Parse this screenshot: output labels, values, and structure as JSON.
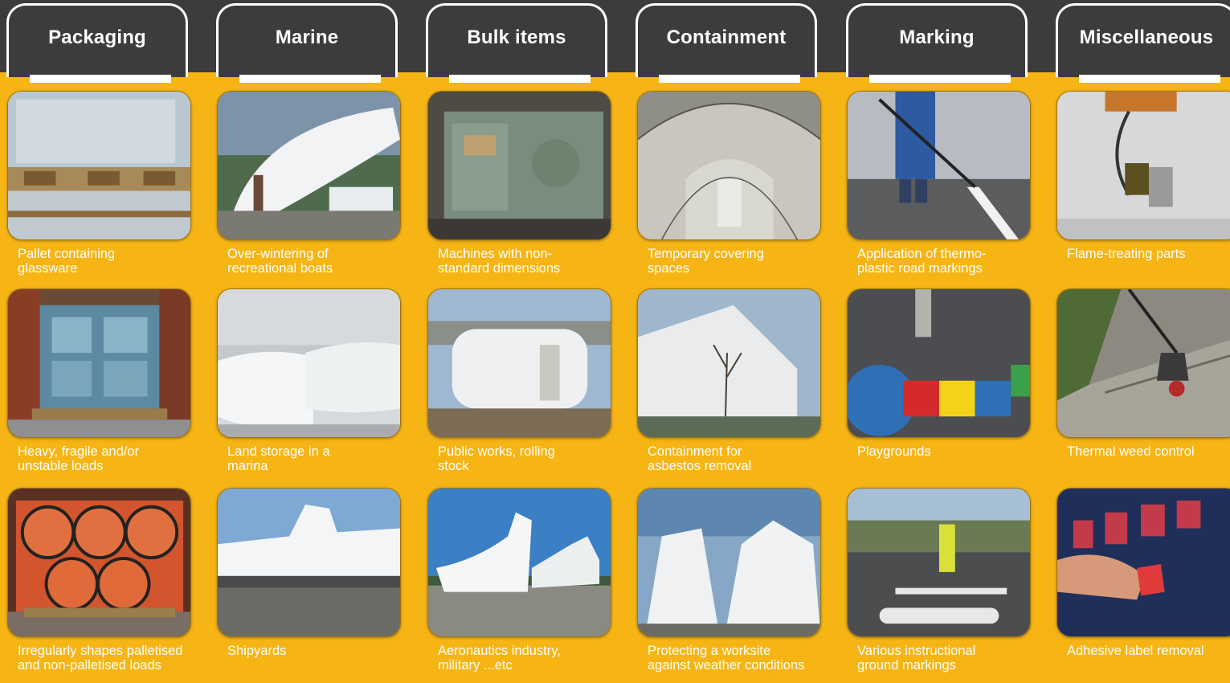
{
  "tabs": [
    {
      "label": "Packaging"
    },
    {
      "label": "Marine"
    },
    {
      "label": "Bulk items"
    },
    {
      "label": "Containment"
    },
    {
      "label": "Marking"
    },
    {
      "label": "Miscellaneous"
    }
  ],
  "columns": [
    {
      "items": [
        {
          "caption": "Pallet containing\nglassware",
          "icon": "pallet-glassware-photo"
        },
        {
          "caption": "Heavy, fragile and/or\nunstable loads",
          "icon": "wrapped-load-photo"
        },
        {
          "caption": "Irregularly shapes palletised\nand non-palletised loads",
          "icon": "irregular-load-photo"
        }
      ]
    },
    {
      "items": [
        {
          "caption": "Over-wintering of\nrecreational boats",
          "icon": "boat-wrapping-photo"
        },
        {
          "caption": "Land storage in a\nmarina",
          "icon": "marina-storage-photo"
        },
        {
          "caption": "Shipyards",
          "icon": "shipyard-photo"
        }
      ]
    },
    {
      "items": [
        {
          "caption": "Machines with non-\nstandard dimensions",
          "icon": "machine-photo"
        },
        {
          "caption": "Public works, rolling\nstock",
          "icon": "rolling-stock-photo"
        },
        {
          "caption": "Aeronautics industry,\nmilitary ...etc",
          "icon": "helicopter-photo"
        }
      ]
    },
    {
      "items": [
        {
          "caption": "Temporary covering\nspaces",
          "icon": "tunnel-photo"
        },
        {
          "caption": "Containment for\nasbestos removal",
          "icon": "asbestos-containment-photo"
        },
        {
          "caption": "Protecting a worksite\nagainst weather conditions",
          "icon": "worksite-photo"
        }
      ]
    },
    {
      "items": [
        {
          "caption": "Application of thermo-\nplastic road markings",
          "icon": "road-marking-photo"
        },
        {
          "caption": "Playgrounds",
          "icon": "hopscotch-photo"
        },
        {
          "caption": "Various instructional\nground markings",
          "icon": "ground-marking-photo"
        }
      ]
    },
    {
      "items": [
        {
          "caption": "Flame-treating parts",
          "icon": "flame-treating-photo"
        },
        {
          "caption": "Thermal weed control",
          "icon": "weed-control-photo"
        },
        {
          "caption": "Adhesive label removal",
          "icon": "label-removal-photo"
        }
      ]
    }
  ],
  "colors": {
    "background": "#f6b515",
    "tabs": "#3c3c3c",
    "text": "#ffffff"
  }
}
